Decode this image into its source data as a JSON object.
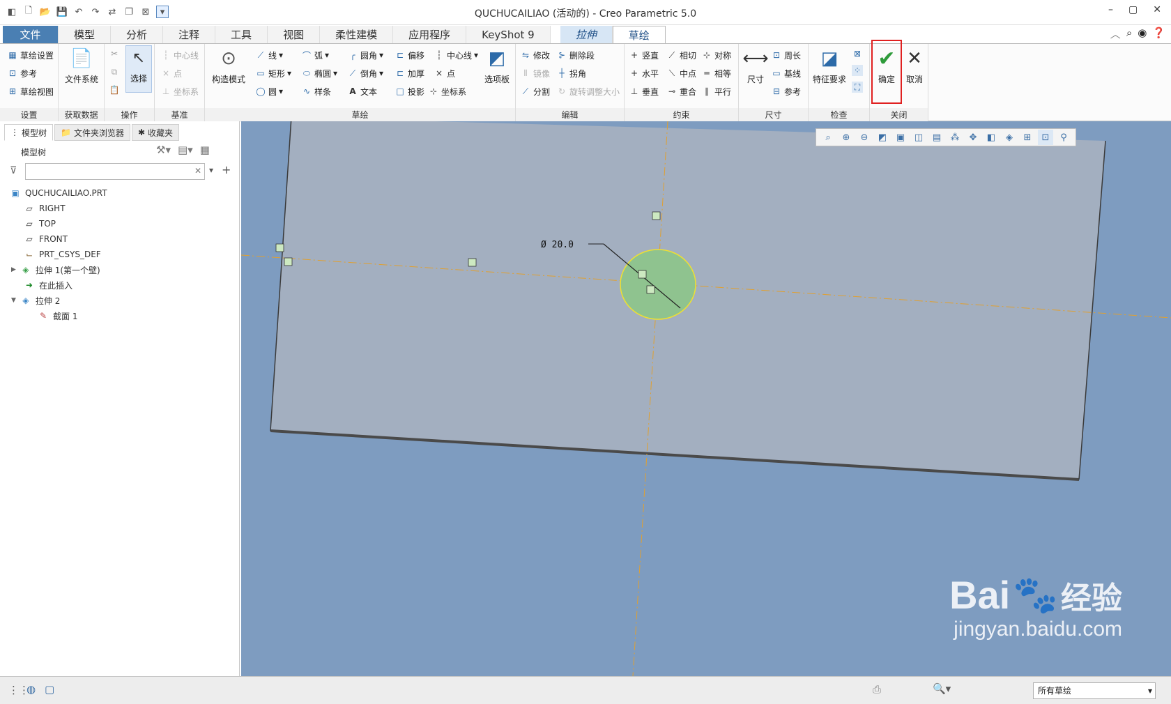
{
  "window": {
    "title": "QUCHUCAILIAO (活动的) - Creo Parametric 5.0"
  },
  "tabs": [
    "文件",
    "模型",
    "分析",
    "注释",
    "工具",
    "视图",
    "柔性建模",
    "应用程序",
    "KeyShot 9",
    "拉伸",
    "草绘"
  ],
  "ribbon": {
    "setup": {
      "items": [
        "草绘设置",
        "参考",
        "草绘视图"
      ],
      "label": "设置"
    },
    "getdata": {
      "items": [
        "文件系统"
      ],
      "label": "获取数据"
    },
    "ops": {
      "items": [
        "选择"
      ],
      "label": "操作"
    },
    "datum": {
      "items": [
        "中心线",
        "点",
        "坐标系"
      ],
      "label": "基准"
    },
    "sketch": {
      "construct": "构造模式",
      "col1": [
        "线",
        "矩形",
        "圆"
      ],
      "col2": [
        "弧",
        "椭圆",
        "样条"
      ],
      "col3": [
        "圆角",
        "倒角",
        "文本"
      ],
      "col4": [
        "偏移",
        "加厚",
        "投影"
      ],
      "col5": [
        "中心线",
        "点",
        "坐标系"
      ],
      "palette": "选项板",
      "label": "草绘"
    },
    "edit": {
      "items": [
        "修改",
        "删除段",
        "镜像",
        "拐角",
        "分割",
        "旋转调整大小"
      ],
      "label": "编辑"
    },
    "constrain": {
      "items": [
        "竖直",
        "相切",
        "对称",
        "水平",
        "中点",
        "相等",
        "垂直",
        "重合",
        "平行"
      ],
      "label": "约束"
    },
    "dimension": {
      "items": [
        "尺寸",
        "周长",
        "基线",
        "参考"
      ],
      "label": "尺寸"
    },
    "inspect": {
      "items": [
        "特征要求"
      ],
      "label": "检查"
    },
    "close": {
      "ok": "确定",
      "cancel": "取消",
      "label": "关闭"
    }
  },
  "nav": {
    "tabs": [
      "模型树",
      "文件夹浏览器",
      "收藏夹"
    ],
    "tree_title": "模型树"
  },
  "tree": [
    {
      "label": "QUCHUCAILIAO.PRT",
      "icon": "part-icon"
    },
    {
      "label": "RIGHT",
      "icon": "datum-plane-icon"
    },
    {
      "label": "TOP",
      "icon": "datum-plane-icon"
    },
    {
      "label": "FRONT",
      "icon": "datum-plane-icon"
    },
    {
      "label": "PRT_CSYS_DEF",
      "icon": "csys-icon"
    },
    {
      "label": "拉伸 1(第一个壁)",
      "icon": "extrude-icon"
    },
    {
      "label": "在此插入",
      "icon": "insert-arrow-icon"
    },
    {
      "label": "拉伸 2",
      "icon": "extrude-icon"
    },
    {
      "label": "截面 1",
      "icon": "sketch-icon"
    }
  ],
  "canvas": {
    "dimension": "Ø 20.0"
  },
  "status": {
    "filter": "所有草绘"
  },
  "watermark": {
    "brand": "Bai",
    "brand2": "经验",
    "url": "jingyan.baidu.com"
  },
  "colors": {
    "accent": "#4a7fb3",
    "canvas": "#7e9cc0",
    "plate": "#a3afc0",
    "sketch_fill": "#8fc38f",
    "ok_highlight": "#e02020"
  }
}
